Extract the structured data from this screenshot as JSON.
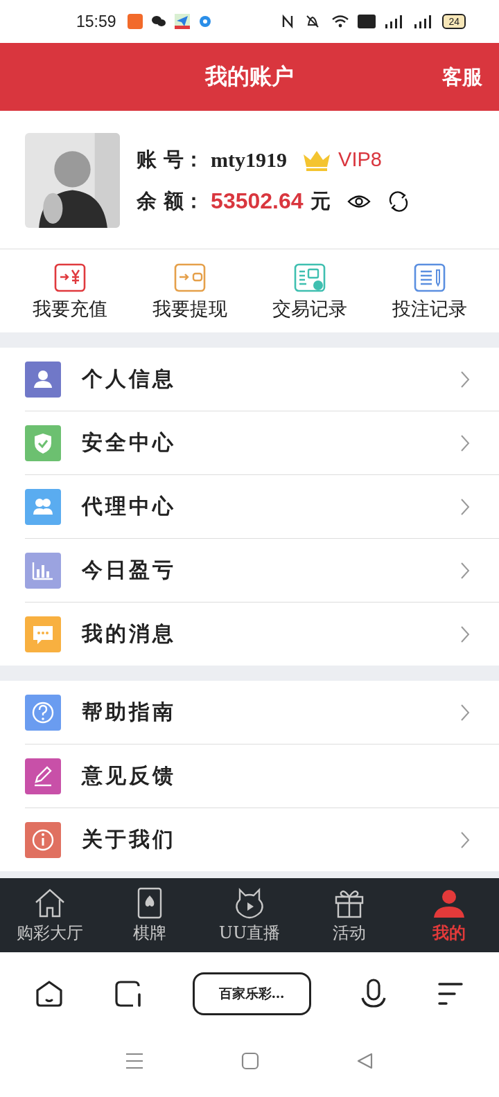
{
  "status_bar": {
    "time": "15:59",
    "battery": "24"
  },
  "header": {
    "title": "我的账户",
    "action": "客服"
  },
  "profile": {
    "account_label": "账 号：",
    "account": "mty1919",
    "vip": "VIP8",
    "balance_label": "余 额：",
    "balance": "53502.64",
    "currency": "元"
  },
  "quick_actions": [
    {
      "label": "我要充值",
      "kind": "recharge",
      "color": "#e03a3e"
    },
    {
      "label": "我要提现",
      "kind": "withdraw",
      "color": "#e5a04a"
    },
    {
      "label": "交易记录",
      "kind": "transactions",
      "color": "#3fbfb0"
    },
    {
      "label": "投注记录",
      "kind": "bets",
      "color": "#5b8fe0"
    }
  ],
  "menu_groups": [
    [
      {
        "label": "个人信息",
        "kind": "person",
        "color": "#7078c8",
        "chevron": true
      },
      {
        "label": "安全中心",
        "kind": "shield",
        "color": "#6cc070",
        "chevron": true
      },
      {
        "label": "代理中心",
        "kind": "people",
        "color": "#5aacf0",
        "chevron": true
      },
      {
        "label": "今日盈亏",
        "kind": "chart",
        "color": "#9ba3e0",
        "chevron": true
      },
      {
        "label": "我的消息",
        "kind": "message",
        "color": "#f8b040",
        "chevron": true
      }
    ],
    [
      {
        "label": "帮助指南",
        "kind": "help",
        "color": "#6a9cf0",
        "chevron": true
      },
      {
        "label": "意见反馈",
        "kind": "edit",
        "color": "#c850a8",
        "chevron": false
      },
      {
        "label": "关于我们",
        "kind": "info",
        "color": "#e07060",
        "chevron": true
      }
    ]
  ],
  "tab_bar": [
    {
      "label": "购彩大厅",
      "kind": "home",
      "selected": false
    },
    {
      "label": "棋牌",
      "kind": "cards",
      "selected": false
    },
    {
      "label": "UU直播",
      "kind": "live",
      "selected": false
    },
    {
      "label": "活动",
      "kind": "gift",
      "selected": false
    },
    {
      "label": "我的",
      "kind": "user",
      "selected": true
    }
  ],
  "browser_bar": {
    "address": "百家乐彩…"
  }
}
